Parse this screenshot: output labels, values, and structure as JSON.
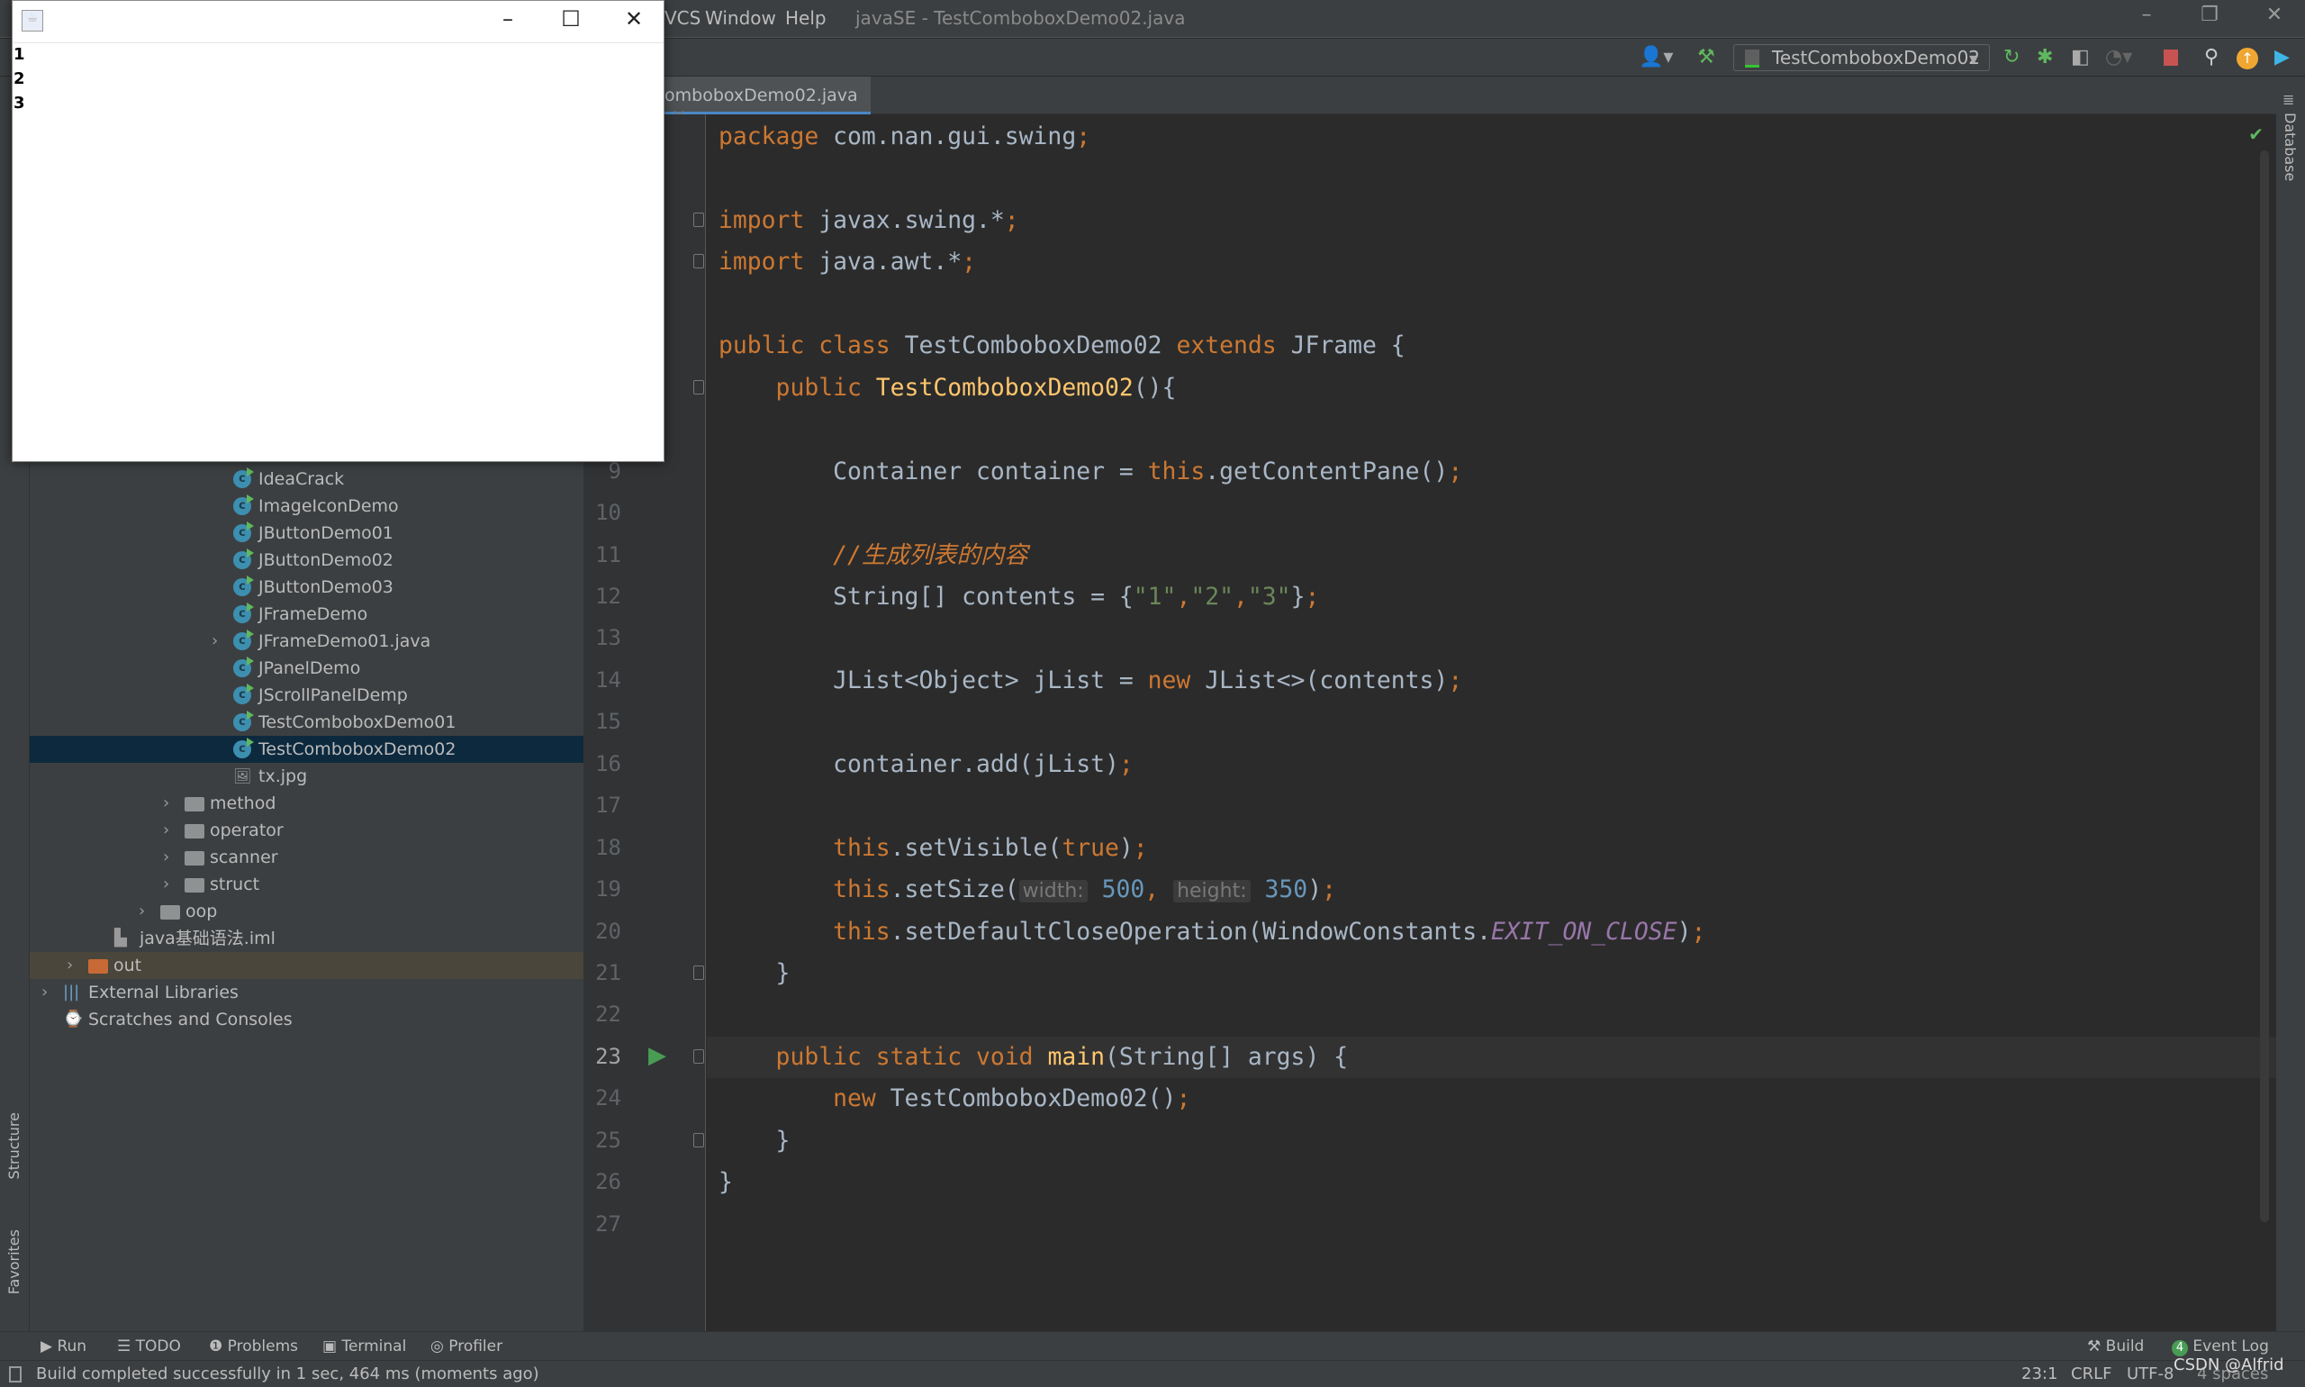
{
  "titlebar": {
    "menus": [
      "VCS",
      "Window",
      "Help"
    ],
    "title": "javaSE - TestComboboxDemo02.java"
  },
  "toolbar": {
    "run_config": "TestComboboxDemo02"
  },
  "tab": {
    "label": "omboboxDemo02.java"
  },
  "side_labels": {
    "structure": "Structure",
    "favorites": "Favorites",
    "database": "Database"
  },
  "project_tree": [
    {
      "label": "IdeaCrack",
      "type": "class",
      "indent": 259
    },
    {
      "label": "ImageIconDemo",
      "type": "class"
    },
    {
      "label": "JButtonDemo01",
      "type": "class"
    },
    {
      "label": "JButtonDemo02",
      "type": "class"
    },
    {
      "label": "JButtonDemo03",
      "type": "class"
    },
    {
      "label": "JFrameDemo",
      "type": "class"
    },
    {
      "label": "JFrameDemo01.java",
      "type": "class",
      "expandable": true
    },
    {
      "label": "JPanelDemo",
      "type": "class"
    },
    {
      "label": "JScrollPanelDemp",
      "type": "class"
    },
    {
      "label": "TestComboboxDemo01",
      "type": "class"
    },
    {
      "label": "TestComboboxDemo02",
      "type": "class",
      "selected": true
    },
    {
      "label": "tx.jpg",
      "type": "image"
    },
    {
      "label": "method",
      "type": "package",
      "expandable": true
    },
    {
      "label": "operator",
      "type": "package",
      "expandable": true
    },
    {
      "label": "scanner",
      "type": "package",
      "expandable": true
    },
    {
      "label": "struct",
      "type": "package",
      "expandable": true
    },
    {
      "label": "oop",
      "type": "package",
      "expandable": true
    },
    {
      "label": "java基础语法.iml",
      "type": "module-file"
    },
    {
      "label": "out",
      "type": "folder-excluded",
      "expandable": true
    },
    {
      "label": "External Libraries",
      "type": "libraries",
      "expandable": true
    },
    {
      "label": "Scratches and Consoles",
      "type": "scratches"
    }
  ],
  "editor": {
    "current_line": 23,
    "lines": [
      [
        [
          "package ",
          "k"
        ],
        [
          "com.nan.gui.swing",
          ""
        ],
        [
          ";",
          "k"
        ]
      ],
      [],
      [
        [
          "import ",
          "k"
        ],
        [
          "javax.swing.*",
          ""
        ],
        [
          ";",
          "k"
        ]
      ],
      [
        [
          "import ",
          "k"
        ],
        [
          "java.awt.*",
          ""
        ],
        [
          ";",
          "k"
        ]
      ],
      [],
      [
        [
          "public class ",
          "k"
        ],
        [
          "TestComboboxDemo02 ",
          ""
        ],
        [
          "extends ",
          "k"
        ],
        [
          "JFrame {",
          ""
        ]
      ],
      [
        [
          "    public ",
          "k"
        ],
        [
          "TestComboboxDemo02",
          "m"
        ],
        [
          "(){",
          ""
        ]
      ],
      [],
      [
        [
          "        Container container = ",
          ""
        ],
        [
          "this",
          "k"
        ],
        [
          ".getContentPane()",
          ""
        ],
        [
          ";",
          "k"
        ]
      ],
      [],
      [
        [
          "        //生成列表的内容",
          "c"
        ]
      ],
      [
        [
          "        String[] contents = {",
          ""
        ],
        [
          "\"1\"",
          "s"
        ],
        [
          ",",
          "k"
        ],
        [
          "\"2\"",
          "s"
        ],
        [
          ",",
          "k"
        ],
        [
          "\"3\"",
          "s"
        ],
        [
          "}",
          ""
        ],
        [
          ";",
          "k"
        ]
      ],
      [],
      [
        [
          "        JList<Object> jList = ",
          ""
        ],
        [
          "new ",
          "k"
        ],
        [
          "JList<>(contents)",
          ""
        ],
        [
          ";",
          "k"
        ]
      ],
      [],
      [
        [
          "        container.add(jList)",
          ""
        ],
        [
          ";",
          "k"
        ]
      ],
      [],
      [
        [
          "        this",
          "k"
        ],
        [
          ".setVisible(",
          ""
        ],
        [
          "true",
          "k"
        ],
        [
          ")",
          ""
        ],
        [
          ";",
          "k"
        ]
      ],
      [
        [
          "        this",
          "k"
        ],
        [
          ".setSize(",
          ""
        ],
        [
          "width:",
          "h"
        ],
        [
          " ",
          ""
        ],
        [
          "500",
          "n"
        ],
        [
          ", ",
          "k"
        ],
        [
          "height:",
          "h"
        ],
        [
          " ",
          ""
        ],
        [
          "350",
          "n"
        ],
        [
          ")",
          ""
        ],
        [
          ";",
          "k"
        ]
      ],
      [
        [
          "        this",
          "k"
        ],
        [
          ".setDefaultCloseOperation(WindowConstants.",
          ""
        ],
        [
          "EXIT_ON_CLOSE",
          "p"
        ],
        [
          ")",
          ""
        ],
        [
          ";",
          "k"
        ]
      ],
      [
        [
          "    }",
          ""
        ]
      ],
      [],
      [
        [
          "    public static void ",
          "k"
        ],
        [
          "main",
          "m"
        ],
        [
          "(String[] args) {",
          ""
        ]
      ],
      [
        [
          "        new ",
          "k"
        ],
        [
          "TestComboboxDemo02()",
          ""
        ],
        [
          ";",
          "k"
        ]
      ],
      [
        [
          "    }",
          ""
        ]
      ],
      [
        [
          "}",
          ""
        ]
      ],
      []
    ]
  },
  "bottom_tools": {
    "run": "Run",
    "todo": "TODO",
    "problems": "Problems",
    "terminal": "Terminal",
    "profiler": "Profiler",
    "build": "Build",
    "event_log": "Event Log",
    "event_count": "4"
  },
  "status": {
    "message": "Build completed successfully in 1 sec, 464 ms (moments ago)",
    "position": "23:1",
    "line_sep": "CRLF",
    "encoding": "UTF-8",
    "indent": "4 spaces",
    "watermark": "CSDN @Alfrid"
  },
  "java_window": {
    "items": [
      "1",
      "2",
      "3"
    ]
  },
  "colors": {
    "keyword": "#cc7832",
    "string": "#6a8759",
    "number": "#6897bb",
    "selection": "#0d293e"
  }
}
